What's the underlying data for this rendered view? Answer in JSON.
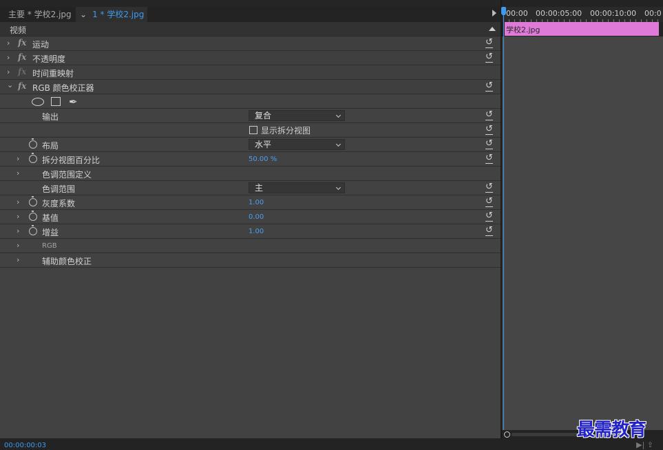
{
  "tabs": {
    "master": "主要 * 学校2.jpg",
    "clip_chevron": "⌄",
    "clip": "1 * 学校2.jpg"
  },
  "section": {
    "label": "视频"
  },
  "effects": [
    {
      "name": "运动"
    },
    {
      "name": "不透明度"
    },
    {
      "name": "时间重映射"
    },
    {
      "name": "RGB 颜色校正器"
    }
  ],
  "fx_label": "fx",
  "reset_glyph": "↺",
  "twirl_closed": "›",
  "twirl_open": "⌄",
  "params": {
    "output_label": "输出",
    "output_value": "复合",
    "show_split_label": "显示拆分视图",
    "layout_label": "布局",
    "layout_value": "水平",
    "split_percent_label": "拆分视图百分比",
    "split_percent_value": "50.00 %",
    "tonal_range_def_label": "色调范围定义",
    "tonal_range_label": "色调范围",
    "tonal_range_value": "主",
    "gamma_label": "灰度系数",
    "gamma_value": "1.00",
    "pedestal_label": "基值",
    "pedestal_value": "0.00",
    "gain_label": "增益",
    "gain_value": "1.00",
    "rgb_label": "RGB",
    "secondary_label": "辅助颜色校正"
  },
  "pen_glyph": "✒",
  "timeline": {
    "ticks": [
      "00:00",
      "00:00:05:00",
      "00:00:10:00",
      "00:0"
    ],
    "clip_name": "学校2.jpg"
  },
  "footer": {
    "timecode": "00:00:00:03",
    "icons": "▶| ⇪"
  },
  "watermark": "最需教育",
  "colors": {
    "accent": "#3e9bf0",
    "clip": "#e07ad8",
    "watermark": "#2222c8"
  }
}
